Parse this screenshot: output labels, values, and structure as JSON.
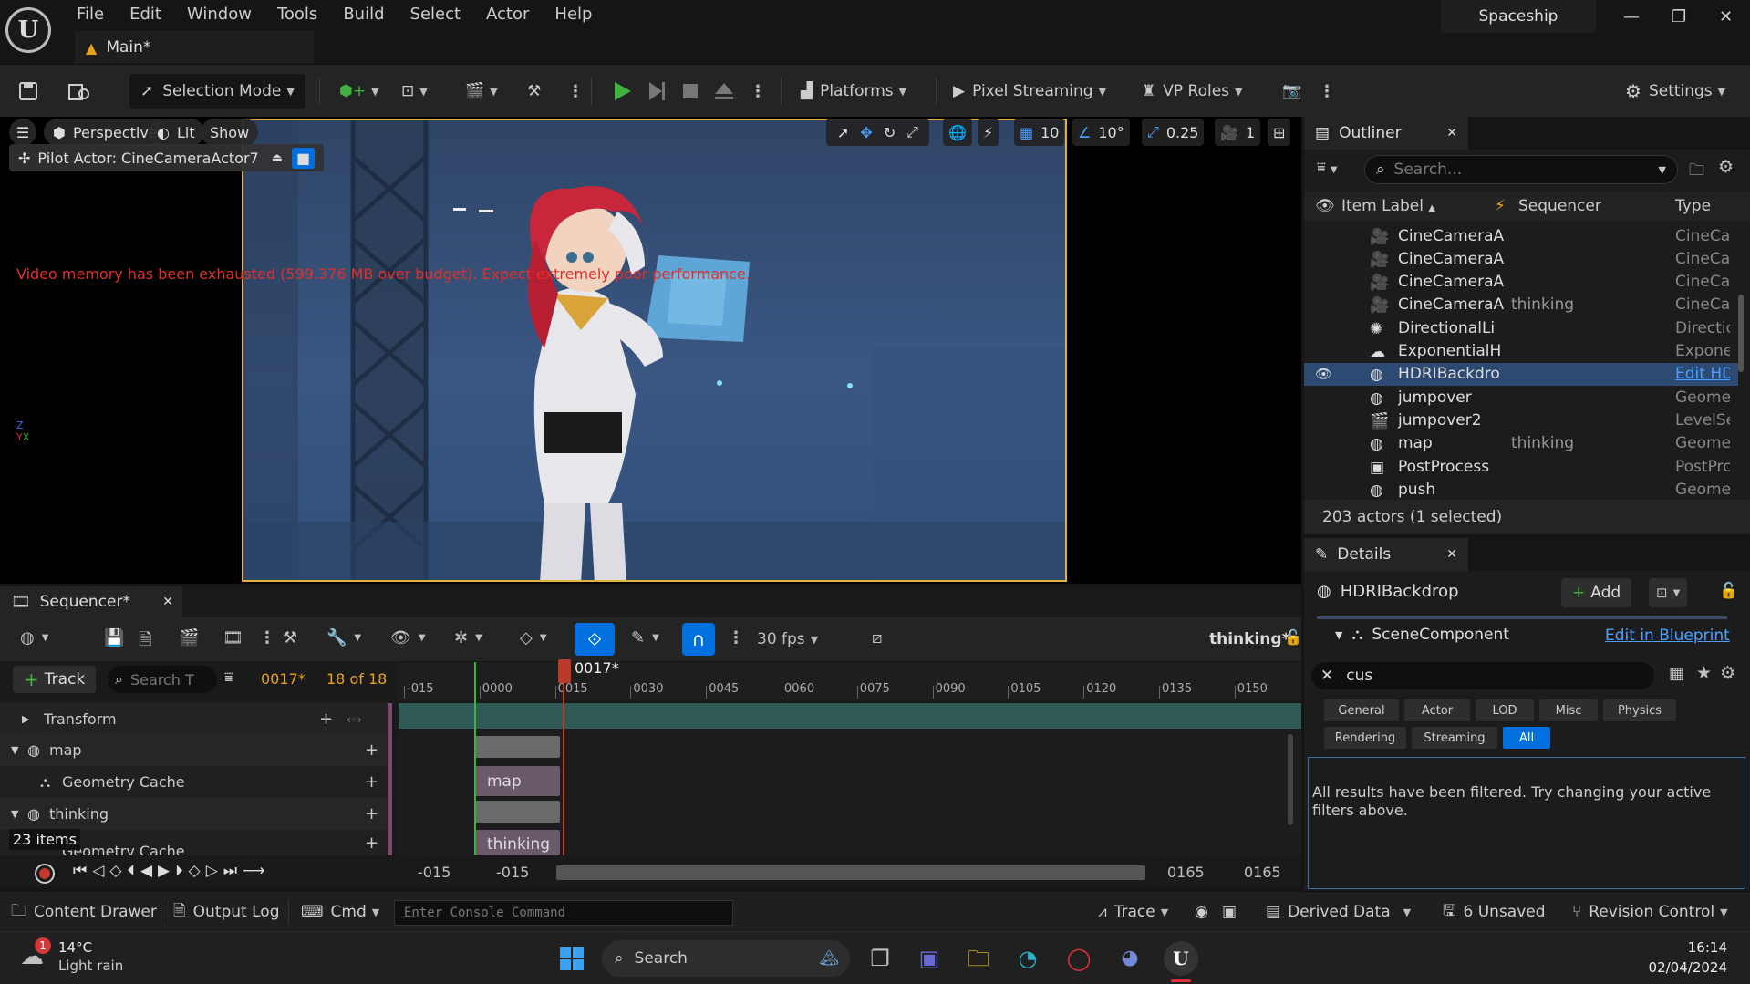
{
  "app": {
    "menu": [
      "File",
      "Edit",
      "Window",
      "Tools",
      "Build",
      "Select",
      "Actor",
      "Help"
    ],
    "tab_title": "Main*",
    "project": "Spaceship"
  },
  "toolbar": {
    "selection_mode": "Selection Mode",
    "platforms": "Platforms",
    "pixel_streaming": "Pixel Streaming",
    "vp_roles": "VP Roles",
    "settings": "Settings"
  },
  "viewport": {
    "perspective": "Perspective",
    "lit": "Lit",
    "show": "Show",
    "pilot": "Pilot Actor: CineCameraActor7",
    "warning": "Video memory has been exhausted (599.376 MB over budget). Expect extremely poor performance.",
    "grid": "10",
    "angle": "10°",
    "scale": "0.25",
    "camspeed": "1"
  },
  "outliner": {
    "title": "Outliner",
    "search_placeholder": "Search...",
    "col_label": "Item Label",
    "col_seq": "Sequencer",
    "col_type": "Type",
    "rows": [
      {
        "label": "CineCameraA",
        "seq": "",
        "type": "CineCar",
        "icon": "camera-icon"
      },
      {
        "label": "CineCameraA",
        "seq": "",
        "type": "CineCar",
        "icon": "camera-icon"
      },
      {
        "label": "CineCameraA",
        "seq": "",
        "type": "CineCar",
        "icon": "camera-icon"
      },
      {
        "label": "CineCameraA",
        "seq": "thinking",
        "type": "CineCar",
        "icon": "camera-icon"
      },
      {
        "label": "DirectionalLi",
        "seq": "",
        "type": "Directio",
        "icon": "sun-icon"
      },
      {
        "label": "ExponentialH",
        "seq": "",
        "type": "Expone",
        "icon": "fog-icon"
      },
      {
        "label": "HDRIBackdro",
        "seq": "",
        "type": "Edit HD",
        "icon": "sphere-icon",
        "selected": true
      },
      {
        "label": "jumpover",
        "seq": "",
        "type": "Geomet",
        "icon": "sphere-icon"
      },
      {
        "label": "jumpover2",
        "seq": "",
        "type": "LevelSe",
        "icon": "clapper-icon"
      },
      {
        "label": "map",
        "seq": "thinking",
        "type": "Geomet",
        "icon": "sphere-icon"
      },
      {
        "label": "PostProcess",
        "seq": "",
        "type": "PostPrc",
        "icon": "postprocess-icon"
      },
      {
        "label": "push",
        "seq": "",
        "type": "Geomet",
        "icon": "sphere-icon"
      }
    ],
    "footer": "203 actors (1 selected)"
  },
  "details": {
    "title": "Details",
    "actor": "HDRIBackdrop",
    "add": "Add",
    "component": "SceneComponent",
    "edit_bp": "Edit in Blueprint",
    "filter": "cus",
    "chips": [
      "General",
      "Actor",
      "LOD",
      "Misc",
      "Physics",
      "Rendering",
      "Streaming",
      "All"
    ],
    "message": "All results have been filtered. Try changing your active filters above."
  },
  "sequencer": {
    "title": "Sequencer*",
    "fps": "30 fps",
    "seq_name": "thinking*",
    "track_btn": "Track",
    "search_placeholder": "Search T",
    "current_frame": "0017*",
    "count": "18 of 18",
    "playhead": "0017*",
    "ticks": [
      "-015",
      "0000",
      "0015",
      "0030",
      "0045",
      "0060",
      "0075",
      "0090",
      "0105",
      "0120",
      "0135",
      "0150"
    ],
    "tracks": {
      "transform": "Transform",
      "map": "map",
      "geo1": "Geometry Cache",
      "thinking": "thinking",
      "geo2": "Geometry Cache"
    },
    "items": "23 items",
    "clip_map": "map",
    "clip_thinking": "thinking",
    "range_start": "-015",
    "range_start2": "-015",
    "range_end": "0165",
    "range_end2": "0165"
  },
  "status": {
    "content_drawer": "Content Drawer",
    "output_log": "Output Log",
    "cmd": "Cmd",
    "console_placeholder": "Enter Console Command",
    "trace": "Trace",
    "derived": "Derived Data",
    "unsaved": "6 Unsaved",
    "revision": "Revision Control"
  },
  "taskbar": {
    "temp": "14°C",
    "weather": "Light rain",
    "badge": "1",
    "search": "Search",
    "time": "16:14",
    "date": "02/04/2024"
  },
  "colors": {
    "accent": "#0070e0",
    "selection_border": "#e2b23a",
    "warning": "#e0302a",
    "play": "#3fb23f",
    "track_teal": "#2f5a55"
  }
}
